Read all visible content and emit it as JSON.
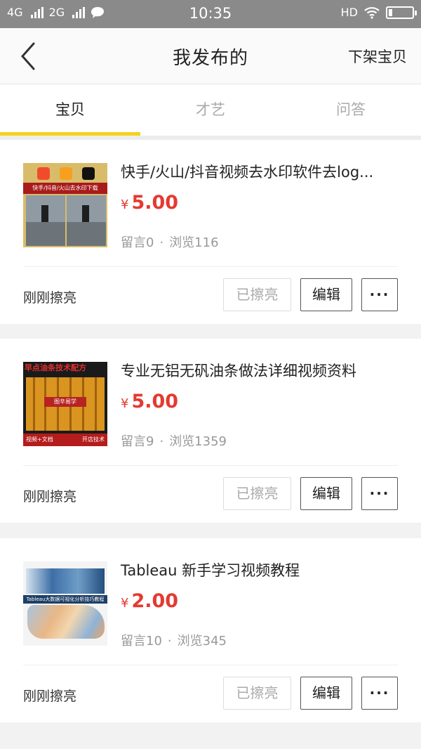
{
  "status_bar": {
    "net1": "4G",
    "net2": "2G",
    "time": "10:35",
    "hd": "HD"
  },
  "header": {
    "title": "我发布的",
    "action": "下架宝贝"
  },
  "tabs": [
    {
      "label": "宝贝",
      "active": true
    },
    {
      "label": "才艺",
      "active": false
    },
    {
      "label": "问答",
      "active": false
    }
  ],
  "products": [
    {
      "title": "快手/火山/抖音视频去水印软件去log...",
      "currency": "¥",
      "price": "5.00",
      "comments": "留言0",
      "views": "浏览116",
      "status": "刚刚擦亮",
      "refresh_label": "已擦亮",
      "edit_label": "编辑",
      "more_label": "···",
      "thumb": {
        "banner": "快手/抖音/火山去水印下载"
      }
    },
    {
      "title": "专业无铝无矾油条做法详细视频资料",
      "currency": "¥",
      "price": "5.00",
      "comments": "留言9",
      "views": "浏览1359",
      "status": "刚刚擦亮",
      "refresh_label": "已擦亮",
      "edit_label": "编辑",
      "more_label": "···",
      "thumb": {
        "head": "早点油条技术配方",
        "mid": "图辛易学",
        "foot_left": "视频+文档",
        "foot_right": "开店技术"
      }
    },
    {
      "title": "Tableau 新手学习视频教程",
      "currency": "¥",
      "price": "2.00",
      "comments": "留言10",
      "views": "浏览345",
      "status": "刚刚擦亮",
      "refresh_label": "已擦亮",
      "edit_label": "编辑",
      "more_label": "···",
      "thumb": {
        "label": "Tableau大数据可视化分析技巧教程"
      }
    }
  ],
  "colors": {
    "accent": "#f5d31b",
    "price": "#e43a30",
    "statusbar": "#8a8a8a"
  }
}
